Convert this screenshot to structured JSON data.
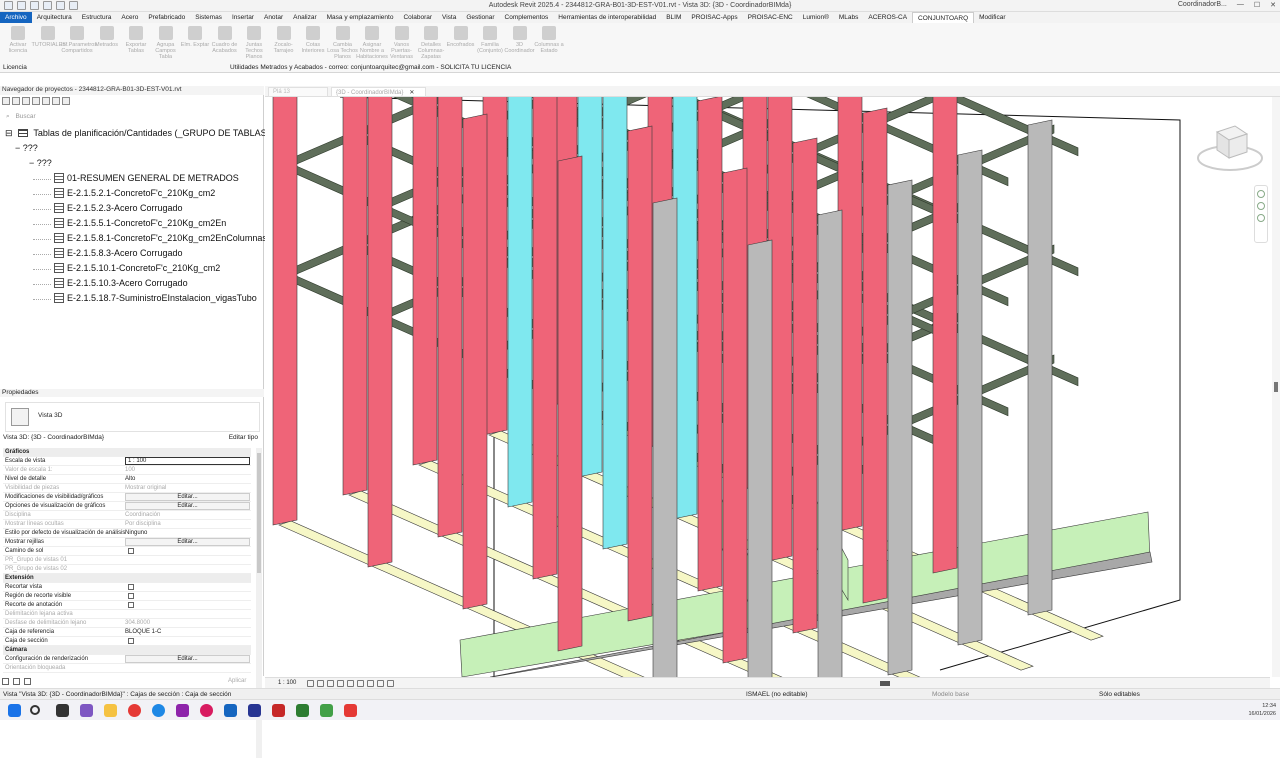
{
  "window": {
    "title": "Autodesk Revit 2025.4 - 2344812-GRA-B01-3D-EST-V01.rvt - Vista 3D: {3D - CoordinadorBIMda}",
    "user": "CoordinadorB..."
  },
  "ribbon_tabs": [
    "Archivo",
    "Arquitectura",
    "Estructura",
    "Acero",
    "Prefabricado",
    "Sistemas",
    "Insertar",
    "Anotar",
    "Analizar",
    "Masa y emplazamiento",
    "Colaborar",
    "Vista",
    "Gestionar",
    "Complementos",
    "Herramientas de interoperabilidad",
    "BLIM",
    "PROISAC-Apps",
    "PROISAC-ENC",
    "Lumion®",
    "MLabs",
    "ACEROS-CA",
    "CONJUNTOARQ",
    "Modificar"
  ],
  "ribbon_buttons": [
    "Activar licencia",
    "TUTORIALES",
    "Inf.Parametros Compartidos",
    "Metrados",
    "Exportar Tablas",
    "Agrupa Campos Tabla",
    "Elm. Exptar",
    "Cuadro de Acabados",
    "Juntas Techos Planos",
    "Zocalo-Tarrajeo",
    "Cotas Interiores",
    "Cambia Losa Techos Planos",
    "Asignar Nombre a Habitaciones",
    "Vanos Puertas-Ventanas",
    "Detalles Columnas-Zapatas",
    "Encofrados",
    "Familia (Conjunto)",
    "3D Coordinador",
    "Columnas a Estado"
  ],
  "ribbon_footer": {
    "licencia": "Licencia",
    "utilidades": "Utilidades Metrados y Acabados - correo: conjuntoarquitec@gmail.com - SOLICITA TU LICENCIA"
  },
  "project_browser": {
    "header": "Navegador de proyectos - 2344812-GRA-B01-3D-EST-V01.rvt",
    "search_placeholder": "Buscar",
    "root": "Tablas de planificación/Cantidades (_GRUPO DE TABLAS)",
    "group1": "???",
    "group2": "???",
    "items": [
      "01-RESUMEN GENERAL DE METRADOS",
      "E-2.1.5.2.1-ConcretoF'c_210Kg_cm2",
      "E-2.1.5.2.3-Acero Corrugado",
      "E-2.1.5.5.1-ConcretoF'c_210Kg_cm2En",
      "E-2.1.5.8.1-ConcretoF'c_210Kg_cm2EnColumnas",
      "E-2.1.5.8.3-Acero Corrugado",
      "E-2.1.5.10.1-ConcretoF'c_210Kg_cm2",
      "E-2.1.5.10.3-Acero Corrugado",
      "E-2.1.5.18.7-SuministroEInstalacion_vigasTubo"
    ]
  },
  "properties": {
    "header": "Propiedades",
    "type_name": "Vista 3D",
    "selector": "Vista 3D: {3D - CoordinadorBIMda}",
    "edit_type": "Editar tipo",
    "apply": "Aplicar",
    "rows": [
      {
        "k": "Gráficos",
        "kind": "section"
      },
      {
        "k": "Escala de vista",
        "v": "1 : 100",
        "kind": "input"
      },
      {
        "k": "Valor de escala    1:",
        "v": "100",
        "kind": "dim"
      },
      {
        "k": "Nivel de detalle",
        "v": "Alto",
        "kind": "text"
      },
      {
        "k": "Visibilidad de piezas",
        "v": "Mostrar original",
        "kind": "dim"
      },
      {
        "k": "Modificaciones de visibilidad/gráficos",
        "v": "Editar...",
        "kind": "button"
      },
      {
        "k": "Opciones de visualización de gráficos",
        "v": "Editar...",
        "kind": "button"
      },
      {
        "k": "Disciplina",
        "v": "Coordinación",
        "kind": "dim"
      },
      {
        "k": "Mostrar líneas ocultas",
        "v": "Por disciplina",
        "kind": "dim"
      },
      {
        "k": "Estilo por defecto de visualización de análisis",
        "v": "Ninguno",
        "kind": "text"
      },
      {
        "k": "Mostrar rejillas",
        "v": "Editar...",
        "kind": "button"
      },
      {
        "k": "Camino de sol",
        "v": "",
        "kind": "check"
      },
      {
        "k": "PR_Grupo de vistas 01",
        "v": "",
        "kind": "dim"
      },
      {
        "k": "PR_Grupo de vistas 02",
        "v": "",
        "kind": "dim"
      },
      {
        "k": "Extensión",
        "kind": "section"
      },
      {
        "k": "Recortar vista",
        "v": "",
        "kind": "check"
      },
      {
        "k": "Región de recorte visible",
        "v": "",
        "kind": "check"
      },
      {
        "k": "Recorte de anotación",
        "v": "",
        "kind": "check"
      },
      {
        "k": "Delimitación lejana activa",
        "v": "",
        "kind": "dim"
      },
      {
        "k": "Desfase de delimitación lejano",
        "v": "304.8000",
        "kind": "dim"
      },
      {
        "k": "Caja de referencia",
        "v": "BLOQUE 1-C",
        "kind": "text"
      },
      {
        "k": "Caja de sección",
        "v": "",
        "kind": "check"
      },
      {
        "k": "Cámara",
        "kind": "section"
      },
      {
        "k": "Configuración de renderización",
        "v": "Editar...",
        "kind": "button"
      },
      {
        "k": "Orientación bloqueada",
        "v": "",
        "kind": "dim"
      }
    ]
  },
  "view_tabs": [
    {
      "label": "Plá 13",
      "active": false
    },
    {
      "label": "{3D - CoordinadorBIMda}",
      "active": true
    }
  ],
  "view_bar": {
    "scale": "1 : 100"
  },
  "status": {
    "message": "Vista \"Vista 3D: {3D - CoordinadorBIMda}\" : Cajas de sección : Caja de sección",
    "workset": "ISMAEL (no editable)",
    "model": "Modelo base",
    "selectable": "Sólo editables"
  },
  "clock": {
    "time": "12:34",
    "date": "16/01/2026"
  },
  "colors": {
    "beam": "#5f6e5a",
    "column_red": "#ef6478",
    "column_cyan": "#7fe8ef",
    "column_grey": "#b9b9b9",
    "wall_green": "#c6f0b8",
    "footing_yellow": "#f6f7c6",
    "file_tab": "#1565c0"
  },
  "icons": [
    "search-icon",
    "house-icon",
    "close-icon",
    "viewcube-icon",
    "table-icon"
  ]
}
